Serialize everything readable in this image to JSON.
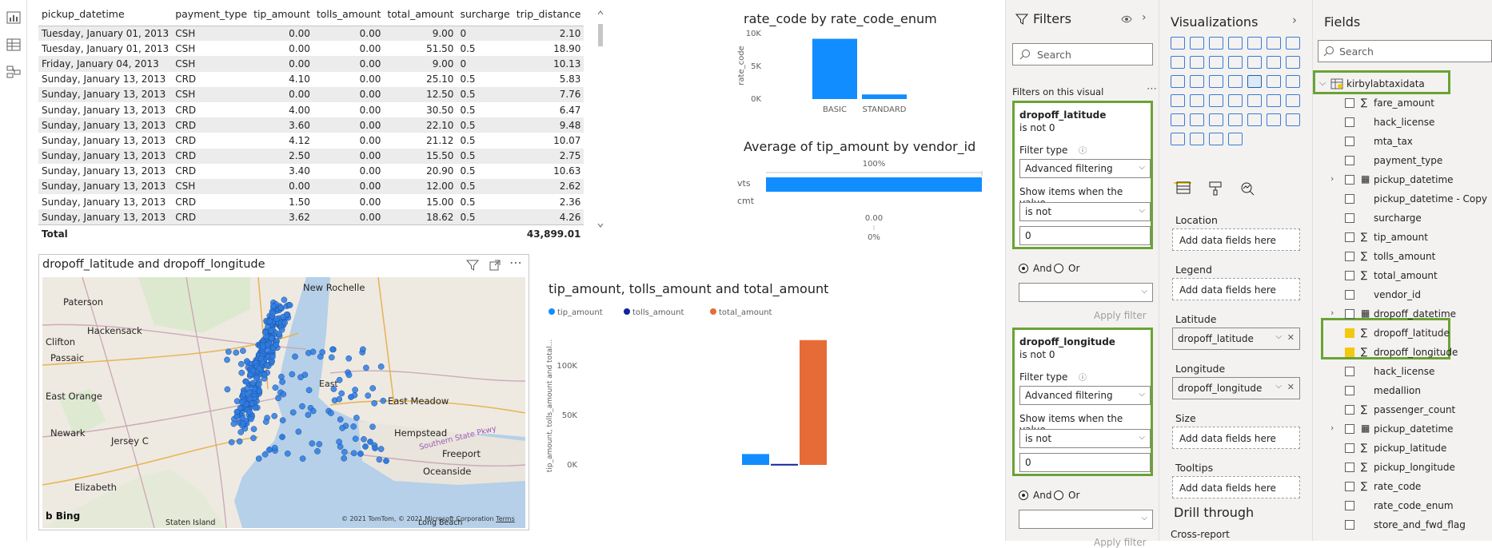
{
  "table": {
    "columns": [
      "pickup_datetime",
      "payment_type",
      "tip_amount",
      "tolls_amount",
      "total_amount",
      "surcharge",
      "trip_distance"
    ],
    "rows": [
      [
        "Tuesday, January 01, 2013",
        "CSH",
        "0.00",
        "0.00",
        "9.00",
        "0",
        "2.10"
      ],
      [
        "Tuesday, January 01, 2013",
        "CSH",
        "0.00",
        "0.00",
        "51.50",
        "0.5",
        "18.90"
      ],
      [
        "Friday, January 04, 2013",
        "CSH",
        "0.00",
        "0.00",
        "9.00",
        "0",
        "10.13"
      ],
      [
        "Sunday, January 13, 2013",
        "CRD",
        "4.10",
        "0.00",
        "25.10",
        "0.5",
        "5.83"
      ],
      [
        "Sunday, January 13, 2013",
        "CSH",
        "0.00",
        "0.00",
        "12.50",
        "0.5",
        "7.76"
      ],
      [
        "Sunday, January 13, 2013",
        "CRD",
        "4.00",
        "0.00",
        "30.50",
        "0.5",
        "6.47"
      ],
      [
        "Sunday, January 13, 2013",
        "CRD",
        "3.60",
        "0.00",
        "22.10",
        "0.5",
        "9.48"
      ],
      [
        "Sunday, January 13, 2013",
        "CRD",
        "4.12",
        "0.00",
        "21.12",
        "0.5",
        "10.07"
      ],
      [
        "Sunday, January 13, 2013",
        "CRD",
        "2.50",
        "0.00",
        "15.50",
        "0.5",
        "2.75"
      ],
      [
        "Sunday, January 13, 2013",
        "CRD",
        "3.40",
        "0.00",
        "20.90",
        "0.5",
        "10.63"
      ],
      [
        "Sunday, January 13, 2013",
        "CSH",
        "0.00",
        "0.00",
        "12.00",
        "0.5",
        "2.62"
      ],
      [
        "Sunday, January 13, 2013",
        "CRD",
        "1.50",
        "0.00",
        "15.00",
        "0.5",
        "2.36"
      ],
      [
        "Sunday, January 13, 2013",
        "CRD",
        "3.62",
        "0.00",
        "18.62",
        "0.5",
        "4.26"
      ]
    ],
    "total_label": "Total",
    "total_value": "43,899.01"
  },
  "map": {
    "title": "dropoff_latitude and dropoff_longitude",
    "places": [
      "Paterson",
      "New Rochelle",
      "Hackensack",
      "Clifton",
      "Passaic",
      "East Orange",
      "Newark",
      "Jersey C",
      "East Meadow",
      "Hempstead",
      "Elizabeth",
      "Freeport",
      "Oceanside",
      "East",
      "Staten Island",
      "Long Beach",
      "Southern State Pkwy"
    ],
    "bing": "Bing",
    "copyright": "© 2021 TomTom, © 2021 Microsoft Corporation",
    "terms": "Terms"
  },
  "chart_data": [
    {
      "type": "bar",
      "title": "rate_code by rate_code_enum",
      "ylabel": "rate_code",
      "categories": [
        "BASIC",
        "STANDARD"
      ],
      "values": [
        9200,
        700
      ],
      "ylim": [
        0,
        10000
      ],
      "yticks": [
        "0K",
        "5K",
        "10K"
      ],
      "color": "#118dff"
    },
    {
      "type": "bar",
      "orientation": "horizontal",
      "title": "Average of tip_amount by vendor_id",
      "categories": [
        "vts",
        "cmt"
      ],
      "values": [
        100,
        0
      ],
      "labels": [
        "100%",
        "0.00"
      ],
      "axis_labels": [
        "100%",
        "0%"
      ],
      "color": "#118dff"
    },
    {
      "type": "bar",
      "title": "tip_amount, tolls_amount and total_amount",
      "ylabel": "tip_amount, tolls_amount and total...",
      "series": [
        {
          "name": "tip_amount",
          "values": [
            11000
          ],
          "color": "#118dff"
        },
        {
          "name": "tolls_amount",
          "values": [
            1000
          ],
          "color": "#12239e"
        },
        {
          "name": "total_amount",
          "values": [
            126000
          ],
          "color": "#e66c37"
        }
      ],
      "yticks": [
        "0K",
        "50K",
        "100K"
      ],
      "ylim": [
        0,
        130000
      ]
    }
  ],
  "filters": {
    "title": "Filters",
    "search_placeholder": "Search",
    "section": "Filters on this visual",
    "cards": [
      {
        "field": "dropoff_latitude",
        "summary": "is not 0",
        "filter_type_label": "Filter type",
        "filter_type": "Advanced filtering",
        "show_label": "Show items when the value",
        "condition": "is not",
        "value": "0",
        "and": "And",
        "or": "Or",
        "apply": "Apply filter"
      },
      {
        "field": "dropoff_longitude",
        "summary": "is not 0",
        "filter_type_label": "Filter type",
        "filter_type": "Advanced filtering",
        "show_label": "Show items when the value",
        "condition": "is not",
        "value": "0",
        "and": "And",
        "or": "Or",
        "apply": "Apply filter"
      }
    ]
  },
  "viz": {
    "title": "Visualizations",
    "wells": [
      {
        "label": "Location",
        "value": "Add data fields here",
        "filled": false
      },
      {
        "label": "Legend",
        "value": "Add data fields here",
        "filled": false
      },
      {
        "label": "Latitude",
        "value": "dropoff_latitude",
        "filled": true
      },
      {
        "label": "Longitude",
        "value": "dropoff_longitude",
        "filled": true
      },
      {
        "label": "Size",
        "value": "Add data fields here",
        "filled": false
      },
      {
        "label": "Tooltips",
        "value": "Add data fields here",
        "filled": false
      }
    ],
    "drill": "Drill through",
    "cross": "Cross-report"
  },
  "fields": {
    "title": "Fields",
    "search_placeholder": "Search",
    "table": "kirbylabtaxidata",
    "items": [
      {
        "name": "fare_amount",
        "sigma": true,
        "checked": false,
        "expand": false,
        "cal": false
      },
      {
        "name": "hack_license",
        "sigma": false,
        "checked": false,
        "expand": false,
        "cal": false
      },
      {
        "name": "mta_tax",
        "sigma": false,
        "checked": false,
        "expand": false,
        "cal": false
      },
      {
        "name": "payment_type",
        "sigma": false,
        "checked": false,
        "expand": false,
        "cal": false
      },
      {
        "name": "pickup_datetime",
        "sigma": false,
        "checked": false,
        "expand": true,
        "cal": true
      },
      {
        "name": "pickup_datetime - Copy",
        "sigma": false,
        "checked": false,
        "expand": false,
        "cal": false
      },
      {
        "name": "surcharge",
        "sigma": false,
        "checked": false,
        "expand": false,
        "cal": false
      },
      {
        "name": "tip_amount",
        "sigma": true,
        "checked": false,
        "expand": false,
        "cal": false
      },
      {
        "name": "tolls_amount",
        "sigma": true,
        "checked": false,
        "expand": false,
        "cal": false
      },
      {
        "name": "total_amount",
        "sigma": true,
        "checked": false,
        "expand": false,
        "cal": false
      },
      {
        "name": "vendor_id",
        "sigma": false,
        "checked": false,
        "expand": false,
        "cal": false
      },
      {
        "name": "dropoff_datetime",
        "sigma": false,
        "checked": false,
        "expand": true,
        "cal": true
      },
      {
        "name": "dropoff_latitude",
        "sigma": true,
        "checked": true,
        "expand": false,
        "cal": false
      },
      {
        "name": "dropoff_longitude",
        "sigma": true,
        "checked": true,
        "expand": false,
        "cal": false
      },
      {
        "name": "hack_license",
        "sigma": false,
        "checked": false,
        "expand": false,
        "cal": false
      },
      {
        "name": "medallion",
        "sigma": false,
        "checked": false,
        "expand": false,
        "cal": false
      },
      {
        "name": "passenger_count",
        "sigma": true,
        "checked": false,
        "expand": false,
        "cal": false
      },
      {
        "name": "pickup_datetime",
        "sigma": false,
        "checked": false,
        "expand": true,
        "cal": true
      },
      {
        "name": "pickup_latitude",
        "sigma": true,
        "checked": false,
        "expand": false,
        "cal": false
      },
      {
        "name": "pickup_longitude",
        "sigma": true,
        "checked": false,
        "expand": false,
        "cal": false
      },
      {
        "name": "rate_code",
        "sigma": true,
        "checked": false,
        "expand": false,
        "cal": false
      },
      {
        "name": "rate_code_enum",
        "sigma": false,
        "checked": false,
        "expand": false,
        "cal": false
      },
      {
        "name": "store_and_fwd_flag",
        "sigma": false,
        "checked": false,
        "expand": false,
        "cal": false
      }
    ]
  }
}
